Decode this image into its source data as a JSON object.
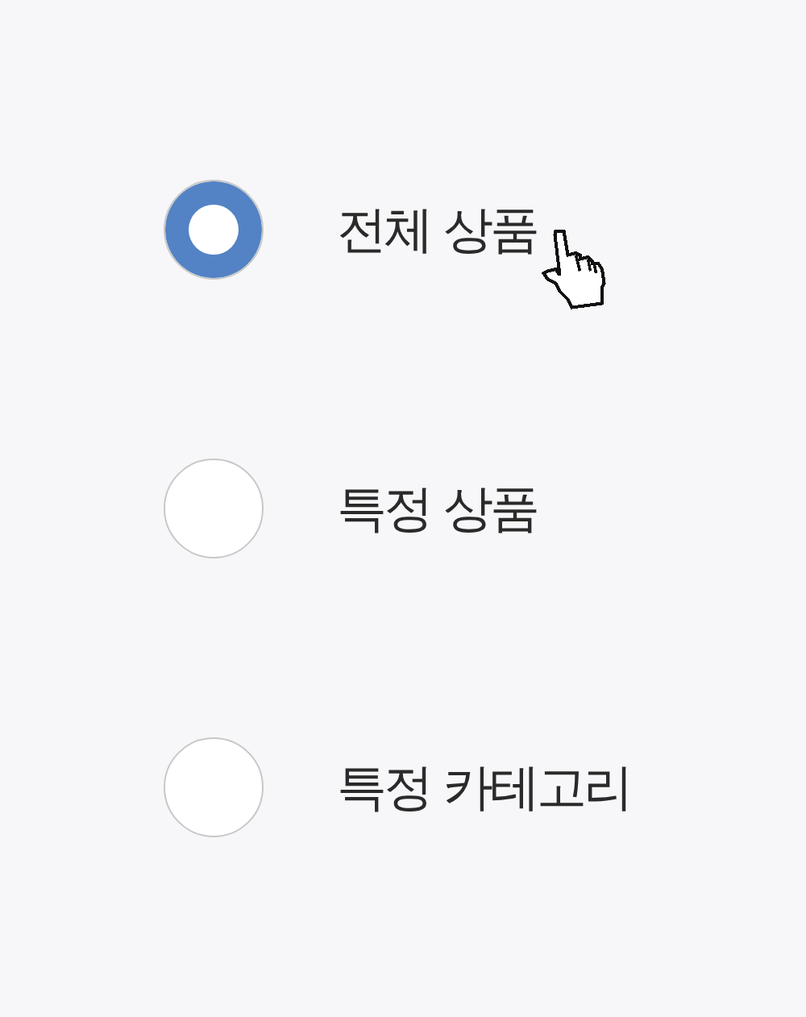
{
  "options": [
    {
      "label": "전체 상품",
      "selected": true,
      "hovered": true
    },
    {
      "label": "특정 상품",
      "selected": false,
      "hovered": false
    },
    {
      "label": "특정 카테고리",
      "selected": false,
      "hovered": false
    }
  ]
}
